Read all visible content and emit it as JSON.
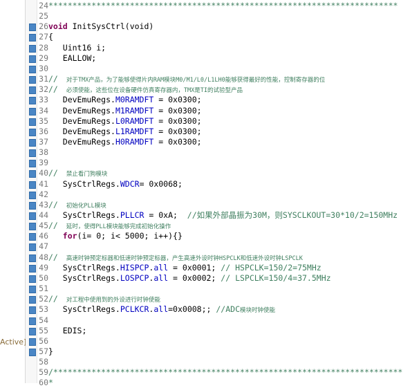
{
  "side_panel": {
    "label": "Active]"
  },
  "lines": [
    {
      "n": "24",
      "parts": [
        {
          "c": "cm",
          "t": "*************************************************************************"
        }
      ]
    },
    {
      "n": "25",
      "parts": []
    },
    {
      "n": "26",
      "fold": true,
      "parts": [
        {
          "c": "kw",
          "t": "void"
        },
        {
          "c": "pl",
          "t": " InitSysCtrl(void)"
        }
      ]
    },
    {
      "n": "27",
      "parts": [
        {
          "c": "pl",
          "t": "{"
        }
      ]
    },
    {
      "n": "28",
      "parts": [
        {
          "c": "pl",
          "t": "   Uint16 i;"
        }
      ]
    },
    {
      "n": "29",
      "parts": [
        {
          "c": "pl",
          "t": "   EALLOW;"
        }
      ]
    },
    {
      "n": "30",
      "parts": []
    },
    {
      "n": "31",
      "parts": [
        {
          "c": "cm",
          "t": "// "
        },
        {
          "c": "cm cm-small",
          "t": " 对于TMX产品，为了能够使得片内RAM模块M0/M1/L0/L1LH0能够获得最好的性能，控制寄存器的位"
        }
      ]
    },
    {
      "n": "32",
      "parts": [
        {
          "c": "cm",
          "t": "// "
        },
        {
          "c": "cm cm-small",
          "t": " 必须使能，这些位在设备硬件仿真寄存器内，TMX是TI的试验型产品"
        }
      ]
    },
    {
      "n": "33",
      "parts": [
        {
          "c": "pl",
          "t": "   DevEmuRegs."
        },
        {
          "c": "field",
          "t": "M0RAMDFT"
        },
        {
          "c": "pl",
          "t": " = 0x0300;"
        }
      ]
    },
    {
      "n": "34",
      "parts": [
        {
          "c": "pl",
          "t": "   DevEmuRegs."
        },
        {
          "c": "field",
          "t": "M1RAMDFT"
        },
        {
          "c": "pl",
          "t": " = 0x0300;"
        }
      ]
    },
    {
      "n": "35",
      "parts": [
        {
          "c": "pl",
          "t": "   DevEmuRegs."
        },
        {
          "c": "field",
          "t": "L0RAMDFT"
        },
        {
          "c": "pl",
          "t": " = 0x0300;"
        }
      ]
    },
    {
      "n": "36",
      "parts": [
        {
          "c": "pl",
          "t": "   DevEmuRegs."
        },
        {
          "c": "field",
          "t": "L1RAMDFT"
        },
        {
          "c": "pl",
          "t": " = 0x0300;"
        }
      ]
    },
    {
      "n": "37",
      "parts": [
        {
          "c": "pl",
          "t": "   DevEmuRegs."
        },
        {
          "c": "field",
          "t": "H0RAMDFT"
        },
        {
          "c": "pl",
          "t": " = 0x0300;"
        }
      ]
    },
    {
      "n": "38",
      "parts": []
    },
    {
      "n": "39",
      "parts": []
    },
    {
      "n": "40",
      "parts": [
        {
          "c": "cm",
          "t": "// "
        },
        {
          "c": "cm cm-small",
          "t": " 禁止看门狗模块"
        }
      ]
    },
    {
      "n": "41",
      "parts": [
        {
          "c": "pl",
          "t": "   SysCtrlRegs."
        },
        {
          "c": "field",
          "t": "WDCR"
        },
        {
          "c": "pl",
          "t": "= 0x0068;"
        }
      ]
    },
    {
      "n": "42",
      "parts": []
    },
    {
      "n": "43",
      "parts": [
        {
          "c": "cm",
          "t": "// "
        },
        {
          "c": "cm cm-small",
          "t": " 初始化PLL模块"
        }
      ]
    },
    {
      "n": "44",
      "parts": [
        {
          "c": "pl",
          "t": "   SysCtrlRegs."
        },
        {
          "c": "field",
          "t": "PLLCR"
        },
        {
          "c": "pl",
          "t": " = 0xA;  "
        },
        {
          "c": "cm",
          "t": "//如果外部晶振为30M，则SYSCLKOUT=30*10/2=150MHz"
        }
      ]
    },
    {
      "n": "45",
      "parts": [
        {
          "c": "cm",
          "t": "// "
        },
        {
          "c": "cm cm-small",
          "t": " 延时，使得PLL模块能够完成初始化操作"
        }
      ]
    },
    {
      "n": "46",
      "parts": [
        {
          "c": "pl",
          "t": "   "
        },
        {
          "c": "kw",
          "t": "for"
        },
        {
          "c": "pl",
          "t": "(i= 0; i< 5000; i++){}"
        }
      ]
    },
    {
      "n": "47",
      "parts": []
    },
    {
      "n": "48",
      "parts": [
        {
          "c": "cm",
          "t": "// "
        },
        {
          "c": "cm cm-small",
          "t": " 高速时钟预定标器和低速时钟预定标器，产生高速外设时钟HSPCLK和低速外设时钟LSPCLK"
        }
      ]
    },
    {
      "n": "49",
      "parts": [
        {
          "c": "pl",
          "t": "   SysCtrlRegs."
        },
        {
          "c": "field",
          "t": "HISPCP"
        },
        {
          "c": "pl",
          "t": "."
        },
        {
          "c": "field",
          "t": "all"
        },
        {
          "c": "pl",
          "t": " = 0x0001; "
        },
        {
          "c": "cm",
          "t": "// HSPCLK=150/2=75MHz"
        }
      ]
    },
    {
      "n": "50",
      "parts": [
        {
          "c": "pl",
          "t": "   SysCtrlRegs."
        },
        {
          "c": "field",
          "t": "LOSPCP"
        },
        {
          "c": "pl",
          "t": "."
        },
        {
          "c": "field",
          "t": "all"
        },
        {
          "c": "pl",
          "t": " = 0x0002; "
        },
        {
          "c": "cm",
          "t": "// LSPCLK=150/4=37.5MHz"
        }
      ]
    },
    {
      "n": "51",
      "parts": []
    },
    {
      "n": "52",
      "parts": [
        {
          "c": "cm",
          "t": "// "
        },
        {
          "c": "cm cm-small",
          "t": " 对工程中使用到的外设进行时钟使能"
        }
      ]
    },
    {
      "n": "53",
      "parts": [
        {
          "c": "pl",
          "t": "   SysCtrlRegs."
        },
        {
          "c": "field",
          "t": "PCLKCR"
        },
        {
          "c": "pl",
          "t": "."
        },
        {
          "c": "field",
          "t": "all"
        },
        {
          "c": "pl",
          "t": "=0x0008;; "
        },
        {
          "c": "cm",
          "t": "//ADC"
        },
        {
          "c": "cm cm-small",
          "t": "模块时钟使能"
        }
      ]
    },
    {
      "n": "54",
      "parts": []
    },
    {
      "n": "55",
      "parts": [
        {
          "c": "pl",
          "t": "   EDIS;"
        }
      ]
    },
    {
      "n": "56",
      "parts": []
    },
    {
      "n": "57",
      "parts": [
        {
          "c": "pl",
          "t": "}"
        }
      ]
    },
    {
      "n": "58",
      "parts": []
    },
    {
      "n": "59",
      "fold": true,
      "parts": [
        {
          "c": "cm",
          "t": "/*************************************************************************"
        }
      ]
    },
    {
      "n": "60",
      "parts": [
        {
          "c": "cm",
          "t": "*"
        }
      ]
    }
  ]
}
